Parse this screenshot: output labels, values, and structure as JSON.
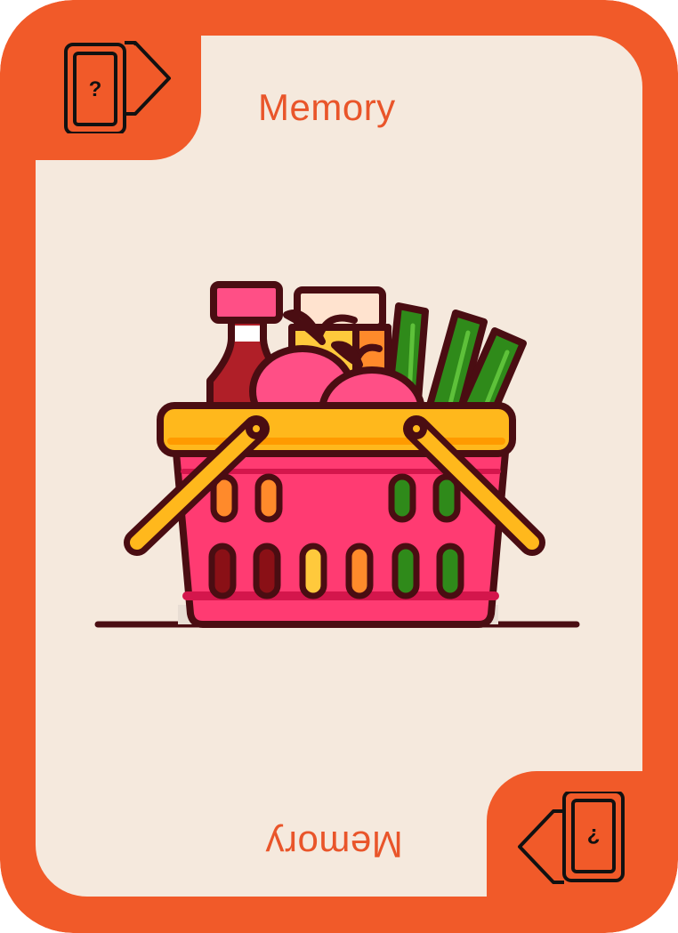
{
  "card": {
    "title": "Memory",
    "title_mirrored": "Memory",
    "corner_icon": "question-card-flip-icon",
    "corner_icon_glyph": "?",
    "illustration": "grocery-basket-illustration"
  },
  "colors": {
    "frame": "#f15a29",
    "face": "#f5e9dd",
    "title": "#e9552a",
    "outline": "#4a0d12",
    "basket": "#ff3b72",
    "handle": "#ffb81c",
    "sauce_cap": "#ff4f86",
    "sauce": "#b01f28",
    "jar_lid": "#ffe3cf",
    "juice": "#ffc93c",
    "juice_side": "#ff8a2b",
    "apple": "#ff4f86",
    "leaf": "#4a9c1e",
    "greens": "#2f8a1a"
  }
}
